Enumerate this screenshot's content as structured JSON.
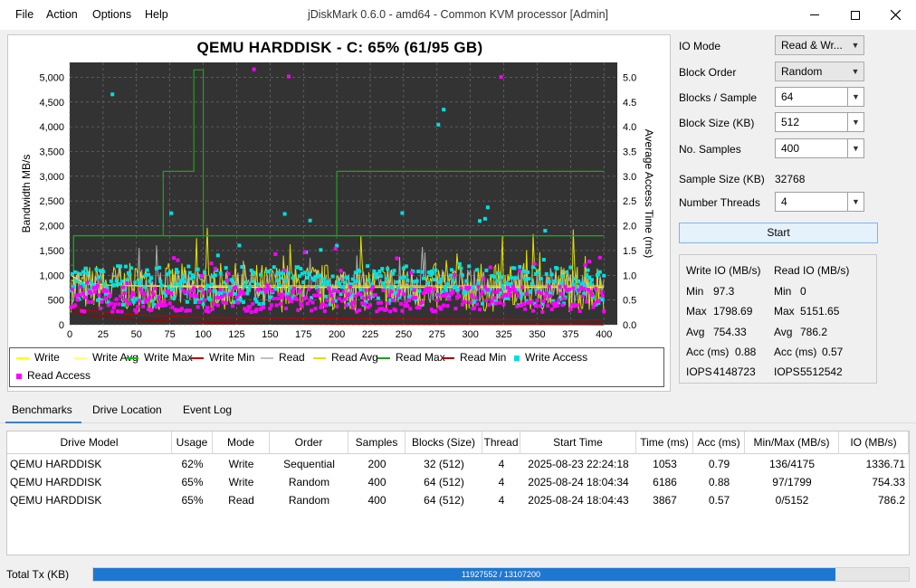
{
  "window": {
    "title": "jDiskMark 0.6.0 - amd64 - Common KVM processor [Admin]",
    "menu": [
      "File",
      "Action",
      "Options",
      "Help"
    ]
  },
  "chart": {
    "title": "QEMU HARDDISK - C: 65% (61/95 GB)",
    "ylabel_left": "Bandwidth MB/s",
    "ylabel_right": "Average Access Time (ms)",
    "legend": [
      "Write",
      "Write Avg",
      "Write Max",
      "Write Min",
      "Read",
      "Read Avg",
      "Read Max",
      "Read Min",
      "Write Access",
      "Read Access"
    ]
  },
  "chart_data": {
    "type": "line",
    "title": "QEMU HARDDISK - C: 65% (61/95 GB)",
    "xlabel": "",
    "ylabel": "Bandwidth MB/s",
    "y2label": "Average Access Time (ms)",
    "xlim": [
      0,
      410
    ],
    "ylim": [
      0,
      5300
    ],
    "y2lim": [
      0,
      5.3
    ],
    "x_ticks": [
      0,
      25,
      50,
      75,
      100,
      125,
      150,
      175,
      200,
      225,
      250,
      275,
      300,
      325,
      350,
      375,
      400
    ],
    "y_ticks": [
      "0",
      "500",
      "1,000",
      "1,500",
      "2,000",
      "2,500",
      "3,000",
      "3,500",
      "4,000",
      "4,500",
      "5,000"
    ],
    "y2_ticks": [
      "0.0",
      "0.5",
      "1.0",
      "1.5",
      "2.0",
      "2.5",
      "3.0",
      "3.5",
      "4.0",
      "4.5",
      "5.0"
    ],
    "grid": true,
    "legend_position": "bottom",
    "series": [
      {
        "name": "Write",
        "color": "#ffff00",
        "style": "noisy",
        "level": 750,
        "spread": 500
      },
      {
        "name": "Write Avg",
        "color": "#ffff80",
        "x": [
          1,
          10,
          30,
          60,
          100,
          150,
          200,
          250,
          300,
          350,
          400
        ],
        "values": [
          1000,
          850,
          800,
          780,
          760,
          755,
          755,
          754,
          754,
          754,
          754
        ]
      },
      {
        "name": "Write Max",
        "color": "#00c000",
        "x": [
          1,
          3,
          3,
          95,
          95,
          97,
          97,
          400
        ],
        "values": [
          1000,
          1000,
          1799,
          1799,
          1799,
          1799,
          1799,
          1799
        ]
      },
      {
        "name": "Write Min",
        "color": "#c00000",
        "x": [
          1,
          10,
          50,
          100,
          200,
          400
        ],
        "values": [
          400,
          300,
          200,
          150,
          120,
          97
        ]
      },
      {
        "name": "Read",
        "color": "#c0c0c0",
        "style": "noisy",
        "level": 780,
        "spread": 350
      },
      {
        "name": "Read Avg",
        "color": "#e0e000",
        "x": [
          1,
          10,
          30,
          60,
          100,
          150,
          200,
          250,
          300,
          350,
          400
        ],
        "values": [
          900,
          820,
          800,
          790,
          788,
          787,
          786,
          786,
          786,
          786,
          786
        ]
      },
      {
        "name": "Read Max",
        "color": "#20a020",
        "x": [
          1,
          3,
          3,
          70,
          70,
          93,
          93,
          100,
          100,
          200,
          200,
          400
        ],
        "values": [
          1200,
          1200,
          1800,
          1800,
          3100,
          3100,
          5151,
          5151,
          1800,
          1800,
          3100,
          3100
        ]
      },
      {
        "name": "Read Min",
        "color": "#a00000",
        "x": [
          1,
          10,
          50,
          100,
          200,
          400
        ],
        "values": [
          300,
          200,
          100,
          50,
          10,
          0
        ]
      },
      {
        "name": "Write Access",
        "color": "#00e0e0",
        "axis": "y2",
        "level": 0.88
      },
      {
        "name": "Read Access",
        "color": "#ff00ff",
        "axis": "y2",
        "level": 0.57
      }
    ]
  },
  "settings": {
    "io_mode_label": "IO Mode",
    "io_mode": "Read & Wr...",
    "block_order_label": "Block Order",
    "block_order": "Random",
    "blocks_sample_label": "Blocks / Sample",
    "blocks_sample": "64",
    "block_size_label": "Block Size (KB)",
    "block_size": "512",
    "samples_label": "No. Samples",
    "samples": "400",
    "sample_size_label": "Sample Size (KB)",
    "sample_size": "32768",
    "threads_label": "Number Threads",
    "threads": "4",
    "start_label": "Start"
  },
  "stats": {
    "write_header": "Write IO (MB/s)",
    "read_header": "Read IO (MB/s)",
    "min_label": "Min",
    "max_label": "Max",
    "avg_label": "Avg",
    "acc_label": "Acc (ms)",
    "iops_label": "IOPS",
    "write_min": "97.3",
    "write_max": "1798.69",
    "write_avg": "754.33",
    "write_acc": "0.88",
    "write_iops": "4148723",
    "read_min": "0",
    "read_max": "5151.65",
    "read_avg": "786.2",
    "read_acc": "0.57",
    "read_iops": "5512542"
  },
  "tabs": [
    "Benchmarks",
    "Drive Location",
    "Event Log"
  ],
  "table": {
    "columns": [
      "Drive Model",
      "Usage",
      "Mode",
      "Order",
      "Samples",
      "Blocks (Size)",
      "Thread",
      "Start Time",
      "Time (ms)",
      "Acc (ms)",
      "Min/Max (MB/s)",
      "IO (MB/s)"
    ],
    "rows": [
      [
        "QEMU HARDDISK",
        "62%",
        "Write",
        "Sequential",
        "200",
        "32 (512)",
        "4",
        "2025-08-23 22:24:18",
        "1053",
        "0.79",
        "136/4175",
        "1336.71"
      ],
      [
        "QEMU HARDDISK",
        "65%",
        "Write",
        "Random",
        "400",
        "64 (512)",
        "4",
        "2025-08-24 18:04:34",
        "6186",
        "0.88",
        "97/1799",
        "754.33"
      ],
      [
        "QEMU HARDDISK",
        "65%",
        "Read",
        "Random",
        "400",
        "64 (512)",
        "4",
        "2025-08-24 18:04:43",
        "3867",
        "0.57",
        "0/5152",
        "786.2"
      ]
    ]
  },
  "footer": {
    "total_label": "Total Tx (KB)",
    "progress_text": "11927552 / 13107200",
    "progress_fraction": 0.91
  }
}
